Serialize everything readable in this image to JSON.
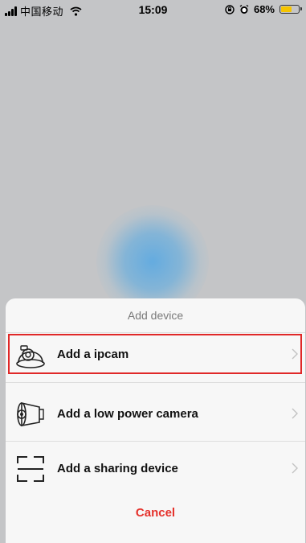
{
  "status_bar": {
    "carrier": "中国移动",
    "time": "15:09",
    "battery_percent": "68%",
    "battery_level": 0.68
  },
  "sheet": {
    "title": "Add device",
    "options": [
      {
        "label": "Add a ipcam",
        "icon": "ip-camera-icon"
      },
      {
        "label": "Add a low power camera",
        "icon": "bullet-camera-icon"
      },
      {
        "label": "Add a sharing device",
        "icon": "scan-frame-icon"
      }
    ],
    "cancel_label": "Cancel"
  },
  "colors": {
    "accent_red": "#e5312b",
    "highlight_border": "#e02828",
    "glow_blue": "#5faae1",
    "battery_yellow": "#f5c400"
  }
}
